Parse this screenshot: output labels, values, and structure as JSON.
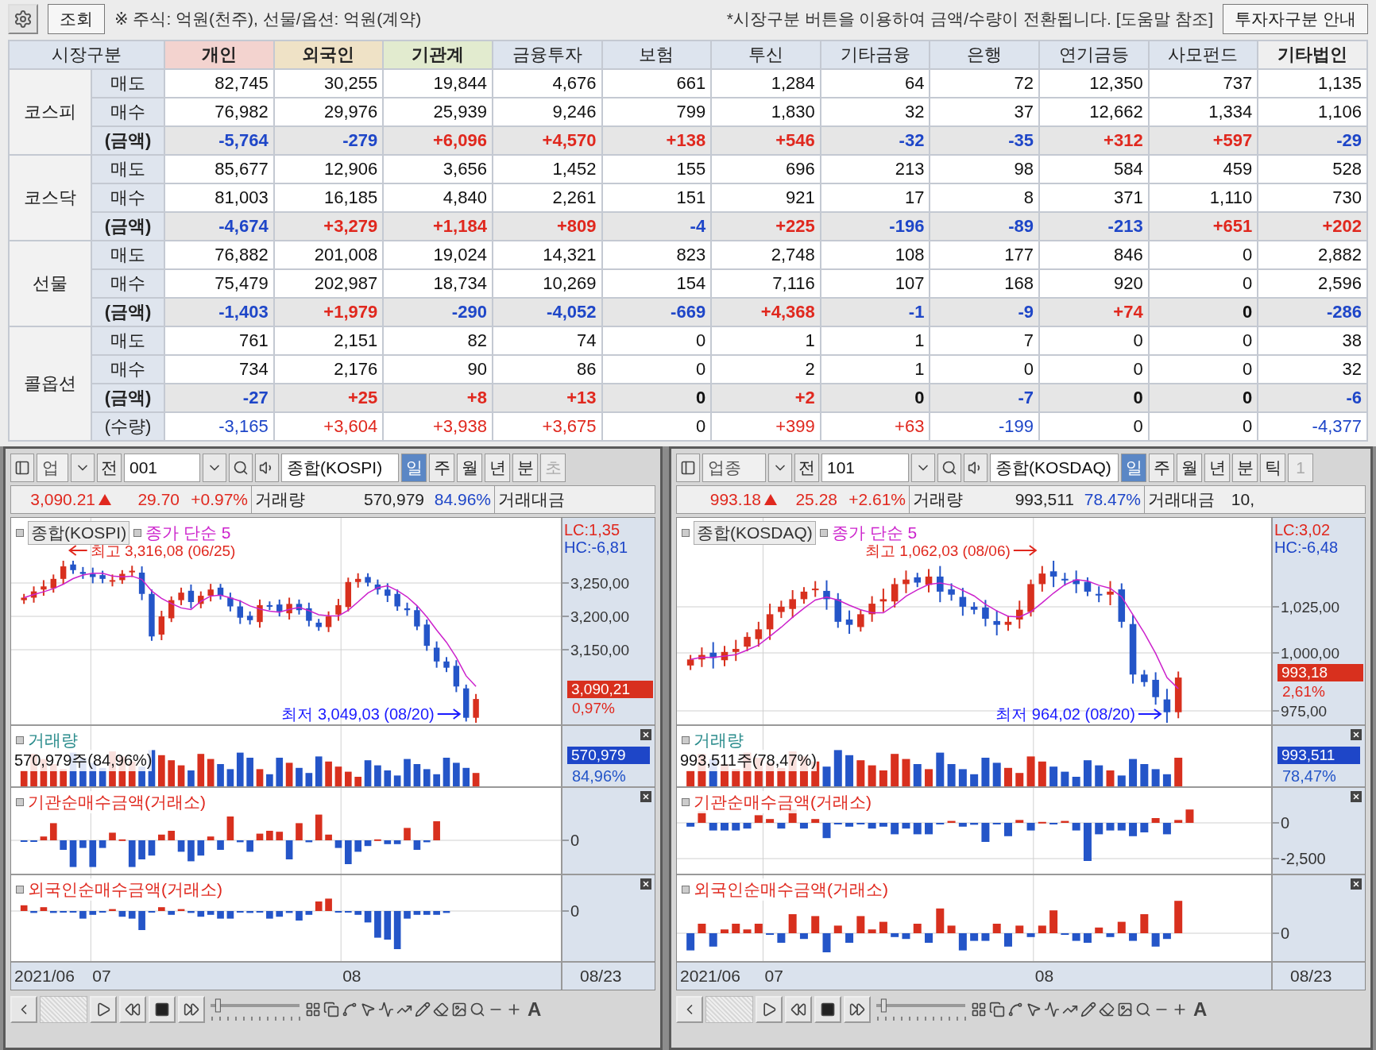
{
  "toolbar": {
    "query_button": "조회",
    "note": "※ 주식: 억원(천주), 선물/옵션: 억원(계약)",
    "hint": "*시장구분 버튼을 이용하여 금액/수량이 전환됩니다. [도움말 참조]",
    "guide_button": "투자자구분 안내"
  },
  "table": {
    "corner": "시장구분",
    "columns": [
      {
        "label": "개인",
        "color": "#f3d3cf",
        "emphasized": true
      },
      {
        "label": "외국인",
        "color": "#efe2c6",
        "emphasized": true
      },
      {
        "label": "기관계",
        "color": "#e2ebcf",
        "emphasized": true
      },
      {
        "label": "금융투자",
        "color": "#dde4ee",
        "emphasized": false
      },
      {
        "label": "보험",
        "color": "#dde4ee",
        "emphasized": false
      },
      {
        "label": "투신",
        "color": "#dde4ee",
        "emphasized": false
      },
      {
        "label": "기타금융",
        "color": "#dde4ee",
        "emphasized": false
      },
      {
        "label": "은행",
        "color": "#dde4ee",
        "emphasized": false
      },
      {
        "label": "연기금등",
        "color": "#dde4ee",
        "emphasized": false
      },
      {
        "label": "사모펀드",
        "color": "#dde4ee",
        "emphasized": false
      },
      {
        "label": "기타법인",
        "color": "#efefef",
        "emphasized": true
      }
    ],
    "groups": [
      {
        "label": "코스피",
        "rows": [
          {
            "label": "매도",
            "kind": "trade",
            "cells": [
              "82,745",
              "30,255",
              "19,844",
              "4,676",
              "661",
              "1,284",
              "64",
              "72",
              "12,350",
              "737",
              "1,135"
            ]
          },
          {
            "label": "매수",
            "kind": "trade",
            "cells": [
              "76,982",
              "29,976",
              "25,939",
              "9,246",
              "799",
              "1,830",
              "32",
              "37",
              "12,662",
              "1,334",
              "1,106"
            ]
          },
          {
            "label": "(금액)",
            "kind": "net",
            "cells": [
              {
                "text": "-5,764",
                "color": "#1e46c8"
              },
              {
                "text": "-279",
                "color": "#1e46c8"
              },
              {
                "text": "+6,096",
                "color": "#e0281e"
              },
              {
                "text": "+4,570",
                "color": "#e0281e"
              },
              {
                "text": "+138",
                "color": "#e0281e"
              },
              {
                "text": "+546",
                "color": "#e0281e"
              },
              {
                "text": "-32",
                "color": "#1e46c8"
              },
              {
                "text": "-35",
                "color": "#1e46c8"
              },
              {
                "text": "+312",
                "color": "#e0281e"
              },
              {
                "text": "+597",
                "color": "#e0281e"
              },
              {
                "text": "-29",
                "color": "#1e46c8"
              }
            ]
          }
        ]
      },
      {
        "label": "코스닥",
        "rows": [
          {
            "label": "매도",
            "kind": "trade",
            "cells": [
              "85,677",
              "12,906",
              "3,656",
              "1,452",
              "155",
              "696",
              "213",
              "98",
              "584",
              "459",
              "528"
            ]
          },
          {
            "label": "매수",
            "kind": "trade",
            "cells": [
              "81,003",
              "16,185",
              "4,840",
              "2,261",
              "151",
              "921",
              "17",
              "8",
              "371",
              "1,110",
              "730"
            ]
          },
          {
            "label": "(금액)",
            "kind": "net",
            "cells": [
              {
                "text": "-4,674",
                "color": "#1e46c8"
              },
              {
                "text": "+3,279",
                "color": "#e0281e"
              },
              {
                "text": "+1,184",
                "color": "#e0281e"
              },
              {
                "text": "+809",
                "color": "#e0281e"
              },
              {
                "text": "-4",
                "color": "#1e46c8"
              },
              {
                "text": "+225",
                "color": "#e0281e"
              },
              {
                "text": "-196",
                "color": "#1e46c8"
              },
              {
                "text": "-89",
                "color": "#1e46c8"
              },
              {
                "text": "-213",
                "color": "#1e46c8"
              },
              {
                "text": "+651",
                "color": "#e0281e"
              },
              {
                "text": "+202",
                "color": "#e0281e"
              }
            ]
          }
        ]
      },
      {
        "label": "선물",
        "rows": [
          {
            "label": "매도",
            "kind": "trade",
            "cells": [
              "76,882",
              "201,008",
              "19,024",
              "14,321",
              "823",
              "2,748",
              "108",
              "177",
              "846",
              "0",
              "2,882"
            ]
          },
          {
            "label": "매수",
            "kind": "trade",
            "cells": [
              "75,479",
              "202,987",
              "18,734",
              "10,269",
              "154",
              "7,116",
              "107",
              "168",
              "920",
              "0",
              "2,596"
            ]
          },
          {
            "label": "(금액)",
            "kind": "net",
            "cells": [
              {
                "text": "-1,403",
                "color": "#1e46c8"
              },
              {
                "text": "+1,979",
                "color": "#e0281e"
              },
              {
                "text": "-290",
                "color": "#1e46c8"
              },
              {
                "text": "-4,052",
                "color": "#1e46c8"
              },
              {
                "text": "-669",
                "color": "#1e46c8"
              },
              {
                "text": "+4,368",
                "color": "#e0281e"
              },
              {
                "text": "-1",
                "color": "#1e46c8"
              },
              {
                "text": "-9",
                "color": "#1e46c8"
              },
              {
                "text": "+74",
                "color": "#e0281e"
              },
              {
                "text": "0",
                "color": "#111111"
              },
              {
                "text": "-286",
                "color": "#1e46c8"
              }
            ]
          }
        ]
      },
      {
        "label": "콜옵션",
        "rows": [
          {
            "label": "매도",
            "kind": "trade",
            "cells": [
              "761",
              "2,151",
              "82",
              "74",
              "0",
              "1",
              "1",
              "7",
              "0",
              "0",
              "38"
            ]
          },
          {
            "label": "매수",
            "kind": "trade",
            "cells": [
              "734",
              "2,176",
              "90",
              "86",
              "0",
              "2",
              "1",
              "0",
              "0",
              "0",
              "32"
            ]
          },
          {
            "label": "(금액)",
            "kind": "net",
            "cells": [
              {
                "text": "-27",
                "color": "#1e46c8"
              },
              {
                "text": "+25",
                "color": "#e0281e"
              },
              {
                "text": "+8",
                "color": "#e0281e"
              },
              {
                "text": "+13",
                "color": "#e0281e"
              },
              {
                "text": "0",
                "color": "#111111"
              },
              {
                "text": "+2",
                "color": "#e0281e"
              },
              {
                "text": "0",
                "color": "#111111"
              },
              {
                "text": "-7",
                "color": "#1e46c8"
              },
              {
                "text": "0",
                "color": "#111111"
              },
              {
                "text": "0",
                "color": "#111111"
              },
              {
                "text": "-6",
                "color": "#1e46c8"
              }
            ]
          },
          {
            "label": "(수량)",
            "kind": "qty",
            "cells": [
              {
                "text": "-3,165",
                "color": "#1e46c8"
              },
              {
                "text": "+3,604",
                "color": "#e0281e"
              },
              {
                "text": "+3,938",
                "color": "#e0281e"
              },
              {
                "text": "+3,675",
                "color": "#e0281e"
              },
              {
                "text": "0",
                "color": "#111111"
              },
              {
                "text": "+399",
                "color": "#e0281e"
              },
              {
                "text": "+63",
                "color": "#e0281e"
              },
              {
                "text": "-199",
                "color": "#1e46c8"
              },
              {
                "text": "0",
                "color": "#111111"
              },
              {
                "text": "0",
                "color": "#111111"
              },
              {
                "text": "-4,377",
                "color": "#1e46c8"
              }
            ]
          }
        ]
      }
    ]
  },
  "panes": [
    {
      "toolbar": {
        "market": "업",
        "prefix": "전",
        "code": "001",
        "name": "종합(KOSPI)",
        "periods": [
          {
            "label": "일",
            "selected": true,
            "disabled": false
          },
          {
            "label": "주",
            "selected": false,
            "disabled": false
          },
          {
            "label": "월",
            "selected": false,
            "disabled": false
          },
          {
            "label": "년",
            "selected": false,
            "disabled": false
          },
          {
            "label": "분",
            "selected": false,
            "disabled": false
          },
          {
            "label": "초",
            "selected": false,
            "disabled": true
          }
        ]
      },
      "quote": {
        "price": "3,090.21",
        "change": "29.70",
        "rate": "+0.97%",
        "volume_label": "거래량",
        "volume": "570,979",
        "volume_ratio": "84.96%",
        "amount_label": "거래대금"
      },
      "price_chart": {
        "legend_name": "종합(KOSPI)",
        "ma_label": "종가 단순 5",
        "high": "최고 3,316,08 (06/25)",
        "low": "최저 3,049,03 (08/20)",
        "lc": "LC:1,35",
        "hc": "HC:-6,81",
        "ticks": [
          "3,250,00",
          "3,200,00",
          "3,150,00"
        ],
        "last_price": "3,090,21",
        "last_rate": "0,97%"
      },
      "volume_chart": {
        "title": "거래량",
        "summary": "570,979주(84,96%)",
        "last": "570,979",
        "ratio": "84,96%"
      },
      "flow_charts": [
        {
          "title": "기관순매수금액(거래소)",
          "ticks": [
            "0"
          ]
        },
        {
          "title": "외국인순매수금액(거래소)",
          "ticks": [
            "0"
          ]
        }
      ],
      "dates": [
        "2021/06",
        "07",
        "08",
        "08/23"
      ],
      "zoom_slider": {
        "level": 0.06
      },
      "font_button": "A"
    },
    {
      "toolbar": {
        "market": "업종",
        "prefix": "전",
        "code": "101",
        "name": "종합(KOSDAQ)",
        "periods": [
          {
            "label": "일",
            "selected": true,
            "disabled": false
          },
          {
            "label": "주",
            "selected": false,
            "disabled": false
          },
          {
            "label": "월",
            "selected": false,
            "disabled": false
          },
          {
            "label": "년",
            "selected": false,
            "disabled": false
          },
          {
            "label": "분",
            "selected": false,
            "disabled": false
          },
          {
            "label": "틱",
            "selected": false,
            "disabled": false
          },
          {
            "label": "1",
            "selected": false,
            "disabled": true
          }
        ]
      },
      "quote": {
        "price": "993.18",
        "change": "25.28",
        "rate": "+2.61%",
        "volume_label": "거래량",
        "volume": "993,511",
        "volume_ratio": "78.47%",
        "amount_label": "거래대금",
        "amount": "10,"
      },
      "price_chart": {
        "legend_name": "종합(KOSDAQ)",
        "ma_label": "종가 단순 5",
        "high": "최고 1,062,03 (08/06)",
        "low": "최저 964,02 (08/20)",
        "lc": "LC:3,02",
        "hc": "HC:-6,48",
        "ticks": [
          "1,025,00",
          "1,000,00",
          "975,00"
        ],
        "last_price": "993,18",
        "last_rate": "2,61%"
      },
      "volume_chart": {
        "title": "거래량",
        "summary": "993,511주(78,47%)",
        "last": "993,511",
        "ratio": "78,47%"
      },
      "flow_charts": [
        {
          "title": "기관순매수금액(거래소)",
          "ticks": [
            "0",
            "-2,500"
          ]
        },
        {
          "title": "외국인순매수금액(거래소)",
          "ticks": [
            "0"
          ]
        }
      ],
      "dates": [
        "2021/06",
        "07",
        "08",
        "08/23"
      ],
      "zoom_slider": {
        "level": 0.06
      },
      "font_button": "A"
    }
  ]
}
